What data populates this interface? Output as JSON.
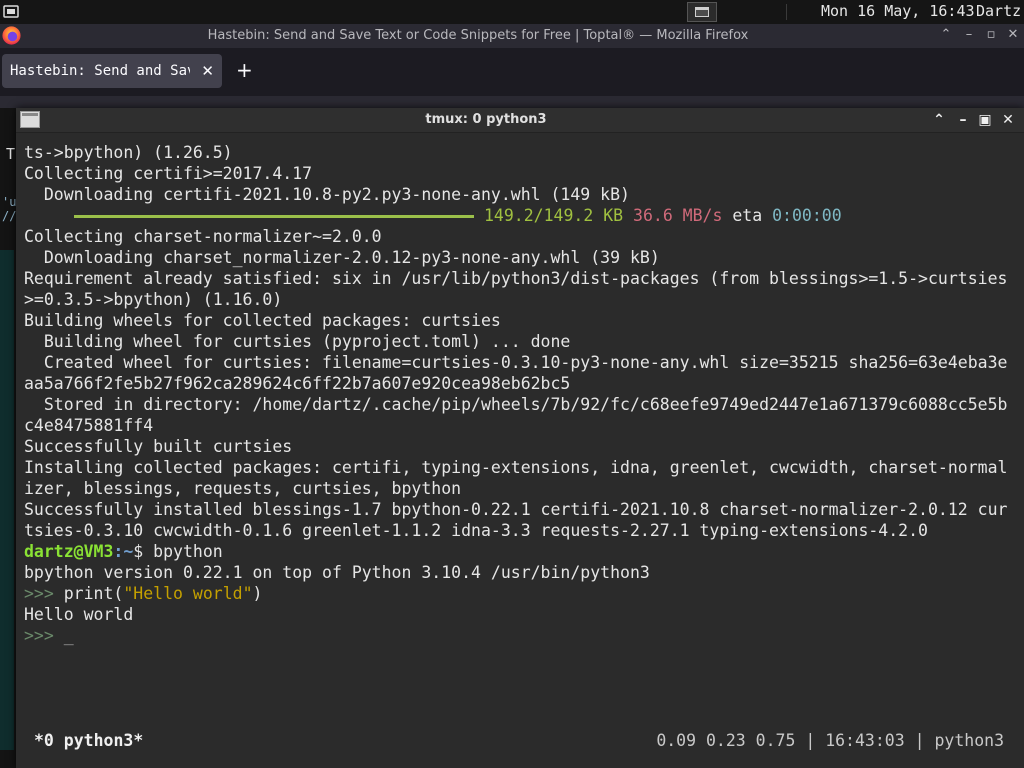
{
  "panel": {
    "clock": "Mon 16 May, 16:43",
    "user": "Dartz"
  },
  "firefox": {
    "window_title": "Hastebin: Send and Save Text or Code Snippets for Free | Toptal® — Mozilla Firefox",
    "tab_label": "Hastebin: Send and Save",
    "tab_close": "✕",
    "new_tab": "+",
    "side_text": "'u\n//",
    "side_letter": "T"
  },
  "terminal": {
    "title": "tmux: 0 python3",
    "lines": [
      "ts->bpython) (1.26.5)",
      "Collecting certifi>=2017.4.17",
      "  Downloading certifi-2021.10.8-py2.py3-none-any.whl (149 kB)",
      "__PROGRESS__",
      "Collecting charset-normalizer~=2.0.0",
      "  Downloading charset_normalizer-2.0.12-py3-none-any.whl (39 kB)",
      "Requirement already satisfied: six in /usr/lib/python3/dist-packages (from blessings>=1.5->curtsies",
      ">=0.3.5->bpython) (1.16.0)",
      "Building wheels for collected packages: curtsies",
      "  Building wheel for curtsies (pyproject.toml) ... done",
      "  Created wheel for curtsies: filename=curtsies-0.3.10-py3-none-any.whl size=35215 sha256=63e4eba3e",
      "aa5a766f2fe5b27f962ca289624c6ff22b7a607e920cea98eb62bc5",
      "  Stored in directory: /home/dartz/.cache/pip/wheels/7b/92/fc/c68eefe9749ed2447e1a671379c6088cc5e5b",
      "c4e8475881ff4",
      "Successfully built curtsies",
      "Installing collected packages: certifi, typing-extensions, idna, greenlet, cwcwidth, charset-normal",
      "izer, blessings, requests, curtsies, bpython",
      "Successfully installed blessings-1.7 bpython-0.22.1 certifi-2021.10.8 charset-normalizer-2.0.12 cur",
      "tsies-0.3.10 cwcwidth-0.1.6 greenlet-1.1.2 idna-3.3 requests-2.27.1 typing-extensions-4.2.0"
    ],
    "progress": {
      "done": "149.2/149.2 KB",
      "speed": "36.6 MB/s",
      "eta_label": "eta",
      "eta": "0:00:00",
      "fraction": 1.0
    },
    "prompt": {
      "user_host": "dartz@VM3",
      "path": ":~",
      "symbol": "$ ",
      "command": "bpython"
    },
    "bpython_banner": "bpython version 0.22.1 on top of Python 3.10.4 /usr/bin/python3",
    "repl": {
      "prompt": ">>> ",
      "code_func": "print",
      "code_open": "(",
      "code_str": "\"Hello world\"",
      "code_close": ")",
      "output": "Hello world",
      "cursor": "_"
    },
    "status": {
      "left": "*0 python3*",
      "right": "0.09 0.23 0.75 | 16:43:03 | python3"
    }
  },
  "colors": {
    "prompt_user": "#8ae234",
    "prompt_path": "#729fcf",
    "progress_bar": "#9bc04a",
    "speed": "#d06a7a"
  }
}
